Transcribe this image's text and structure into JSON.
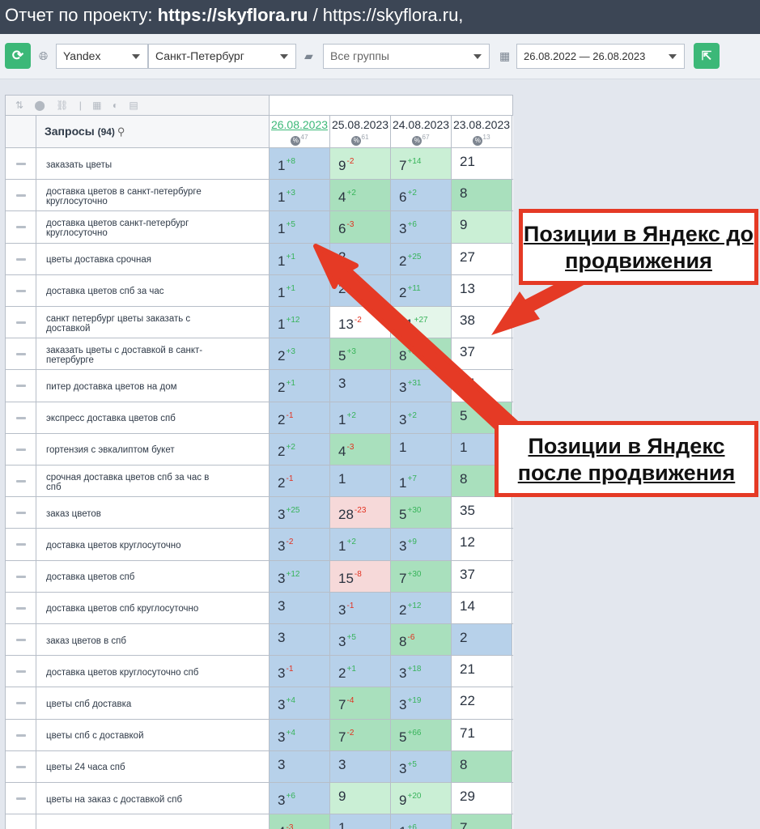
{
  "title": {
    "prefix": "Отчет по проекту: ",
    "domain": "https://skyflora.ru",
    "suffix": " / https://skyflora.ru,"
  },
  "toolbar": {
    "engine": "Yandex",
    "region": "Санкт-Петербург",
    "group": "Все группы",
    "date_range": "26.08.2022 — 26.08.2023",
    "refresh_icon": "refresh-icon",
    "export_icon": "export-icon"
  },
  "table": {
    "tools": "⇅ ⬤ ⛓ | ▦ ◐ ▤",
    "header_label": "Запросы",
    "header_count": "(94)",
    "dates": [
      {
        "date": "26.08.2023",
        "pct": "47"
      },
      {
        "date": "25.08.2023",
        "pct": "61"
      },
      {
        "date": "24.08.2023",
        "pct": "67"
      },
      {
        "date": "23.08.2023",
        "pct": "13"
      }
    ],
    "rows": [
      {
        "query": "заказать цветы",
        "cells": [
          [
            "1",
            "8",
            "up",
            "blue"
          ],
          [
            "9",
            "2",
            "dn",
            "lgreen"
          ],
          [
            "7",
            "14",
            "up",
            "lgreen"
          ],
          [
            "21",
            "",
            "",
            "white"
          ]
        ]
      },
      {
        "query": "доставка цветов в санкт-петербурге круглосуточно",
        "cells": [
          [
            "1",
            "3",
            "up",
            "blue"
          ],
          [
            "4",
            "2",
            "up",
            "green"
          ],
          [
            "6",
            "2",
            "up",
            "blue"
          ],
          [
            "8",
            "",
            "",
            "green"
          ]
        ]
      },
      {
        "query": "доставка цветов санкт-петербург круглосуточно",
        "cells": [
          [
            "1",
            "5",
            "up",
            "blue"
          ],
          [
            "6",
            "3",
            "dn",
            "green"
          ],
          [
            "3",
            "6",
            "up",
            "blue"
          ],
          [
            "9",
            "",
            "",
            "lgreen"
          ]
        ]
      },
      {
        "query": "цветы доставка срочная",
        "cells": [
          [
            "1",
            "1",
            "up",
            "blue"
          ],
          [
            "2",
            "",
            "",
            "blue"
          ],
          [
            "2",
            "25",
            "up",
            "blue"
          ],
          [
            "27",
            "",
            "",
            "white"
          ]
        ]
      },
      {
        "query": "доставка цветов спб за час",
        "cells": [
          [
            "1",
            "1",
            "up",
            "blue"
          ],
          [
            "2",
            "",
            "",
            "blue"
          ],
          [
            "2",
            "11",
            "up",
            "blue"
          ],
          [
            "13",
            "",
            "",
            "white"
          ]
        ]
      },
      {
        "query": "санкт петербург цветы заказать с доставкой",
        "cells": [
          [
            "1",
            "12",
            "up",
            "blue"
          ],
          [
            "13",
            "2",
            "dn",
            "white"
          ],
          [
            "11",
            "27",
            "up",
            "pale"
          ],
          [
            "38",
            "",
            "",
            "white"
          ]
        ]
      },
      {
        "query": "заказать цветы с доставкой в санкт-петербурге",
        "cells": [
          [
            "2",
            "3",
            "up",
            "blue"
          ],
          [
            "5",
            "3",
            "up",
            "green"
          ],
          [
            "8",
            "29",
            "up",
            "green"
          ],
          [
            "37",
            "",
            "",
            "white"
          ]
        ]
      },
      {
        "query": "питер доставка цветов на дом",
        "cells": [
          [
            "2",
            "1",
            "up",
            "blue"
          ],
          [
            "3",
            "",
            "",
            "blue"
          ],
          [
            "3",
            "31",
            "up",
            "blue"
          ],
          [
            "34",
            "",
            "",
            "white"
          ]
        ]
      },
      {
        "query": "экспресс доставка цветов спб",
        "cells": [
          [
            "2",
            "1",
            "dn",
            "blue"
          ],
          [
            "1",
            "2",
            "up",
            "blue"
          ],
          [
            "3",
            "2",
            "up",
            "blue"
          ],
          [
            "5",
            "",
            "",
            "green"
          ]
        ]
      },
      {
        "query": "гортензия с эвкалиптом букет",
        "cells": [
          [
            "2",
            "2",
            "up",
            "blue"
          ],
          [
            "4",
            "3",
            "dn",
            "green"
          ],
          [
            "1",
            "",
            "",
            "blue"
          ],
          [
            "1",
            "",
            "",
            "blue"
          ]
        ]
      },
      {
        "query": "срочная доставка цветов спб за час в спб",
        "cells": [
          [
            "2",
            "1",
            "dn",
            "blue"
          ],
          [
            "1",
            "",
            "",
            "blue"
          ],
          [
            "1",
            "7",
            "up",
            "blue"
          ],
          [
            "8",
            "",
            "",
            "green"
          ]
        ]
      },
      {
        "query": "заказ цветов",
        "cells": [
          [
            "3",
            "25",
            "up",
            "blue"
          ],
          [
            "28",
            "23",
            "dn",
            "pink"
          ],
          [
            "5",
            "30",
            "up",
            "green"
          ],
          [
            "35",
            "",
            "",
            "white"
          ]
        ]
      },
      {
        "query": "доставка цветов круглосуточно",
        "cells": [
          [
            "3",
            "2",
            "dn",
            "blue"
          ],
          [
            "1",
            "2",
            "up",
            "blue"
          ],
          [
            "3",
            "9",
            "up",
            "blue"
          ],
          [
            "12",
            "",
            "",
            "white"
          ]
        ]
      },
      {
        "query": "доставка цветов спб",
        "cells": [
          [
            "3",
            "12",
            "up",
            "blue"
          ],
          [
            "15",
            "8",
            "dn",
            "pink"
          ],
          [
            "7",
            "30",
            "up",
            "green"
          ],
          [
            "37",
            "",
            "",
            "white"
          ]
        ]
      },
      {
        "query": "доставка цветов спб круглосуточно",
        "cells": [
          [
            "3",
            "",
            "",
            "blue"
          ],
          [
            "3",
            "1",
            "dn",
            "blue"
          ],
          [
            "2",
            "12",
            "up",
            "blue"
          ],
          [
            "14",
            "",
            "",
            "white"
          ]
        ]
      },
      {
        "query": "заказ цветов в спб",
        "cells": [
          [
            "3",
            "",
            "",
            "blue"
          ],
          [
            "3",
            "5",
            "up",
            "blue"
          ],
          [
            "8",
            "6",
            "dn",
            "green"
          ],
          [
            "2",
            "",
            "",
            "blue"
          ]
        ]
      },
      {
        "query": "доставка цветов круглосуточно спб",
        "cells": [
          [
            "3",
            "1",
            "dn",
            "blue"
          ],
          [
            "2",
            "1",
            "up",
            "blue"
          ],
          [
            "3",
            "18",
            "up",
            "blue"
          ],
          [
            "21",
            "",
            "",
            "white"
          ]
        ]
      },
      {
        "query": "цветы спб доставка",
        "cells": [
          [
            "3",
            "4",
            "up",
            "blue"
          ],
          [
            "7",
            "4",
            "dn",
            "green"
          ],
          [
            "3",
            "19",
            "up",
            "blue"
          ],
          [
            "22",
            "",
            "",
            "white"
          ]
        ]
      },
      {
        "query": "цветы спб с доставкой",
        "cells": [
          [
            "3",
            "4",
            "up",
            "blue"
          ],
          [
            "7",
            "2",
            "dn",
            "green"
          ],
          [
            "5",
            "66",
            "up",
            "green"
          ],
          [
            "71",
            "",
            "",
            "white"
          ]
        ]
      },
      {
        "query": "цветы 24 часа спб",
        "cells": [
          [
            "3",
            "",
            "",
            "blue"
          ],
          [
            "3",
            "",
            "",
            "blue"
          ],
          [
            "3",
            "5",
            "up",
            "blue"
          ],
          [
            "8",
            "",
            "",
            "green"
          ]
        ]
      },
      {
        "query": "цветы на заказ с доставкой спб",
        "cells": [
          [
            "3",
            "6",
            "up",
            "blue"
          ],
          [
            "9",
            "",
            "",
            "lgreen"
          ],
          [
            "9",
            "20",
            "up",
            "lgreen"
          ],
          [
            "29",
            "",
            "",
            "white"
          ]
        ]
      },
      {
        "query": "",
        "cells": [
          [
            "4",
            "3",
            "dn",
            "green"
          ],
          [
            "1",
            "",
            "",
            "blue"
          ],
          [
            "1",
            "6",
            "up",
            "blue"
          ],
          [
            "7",
            "",
            "",
            "green"
          ]
        ]
      }
    ]
  },
  "callouts": {
    "before": "Позиции в Яндекс до продвижения",
    "after": "Позиции в Яндекс после продвижения"
  },
  "colors": {
    "accent": "#3cb878",
    "callout": "#e53a25",
    "titlebar": "#3c4655"
  }
}
